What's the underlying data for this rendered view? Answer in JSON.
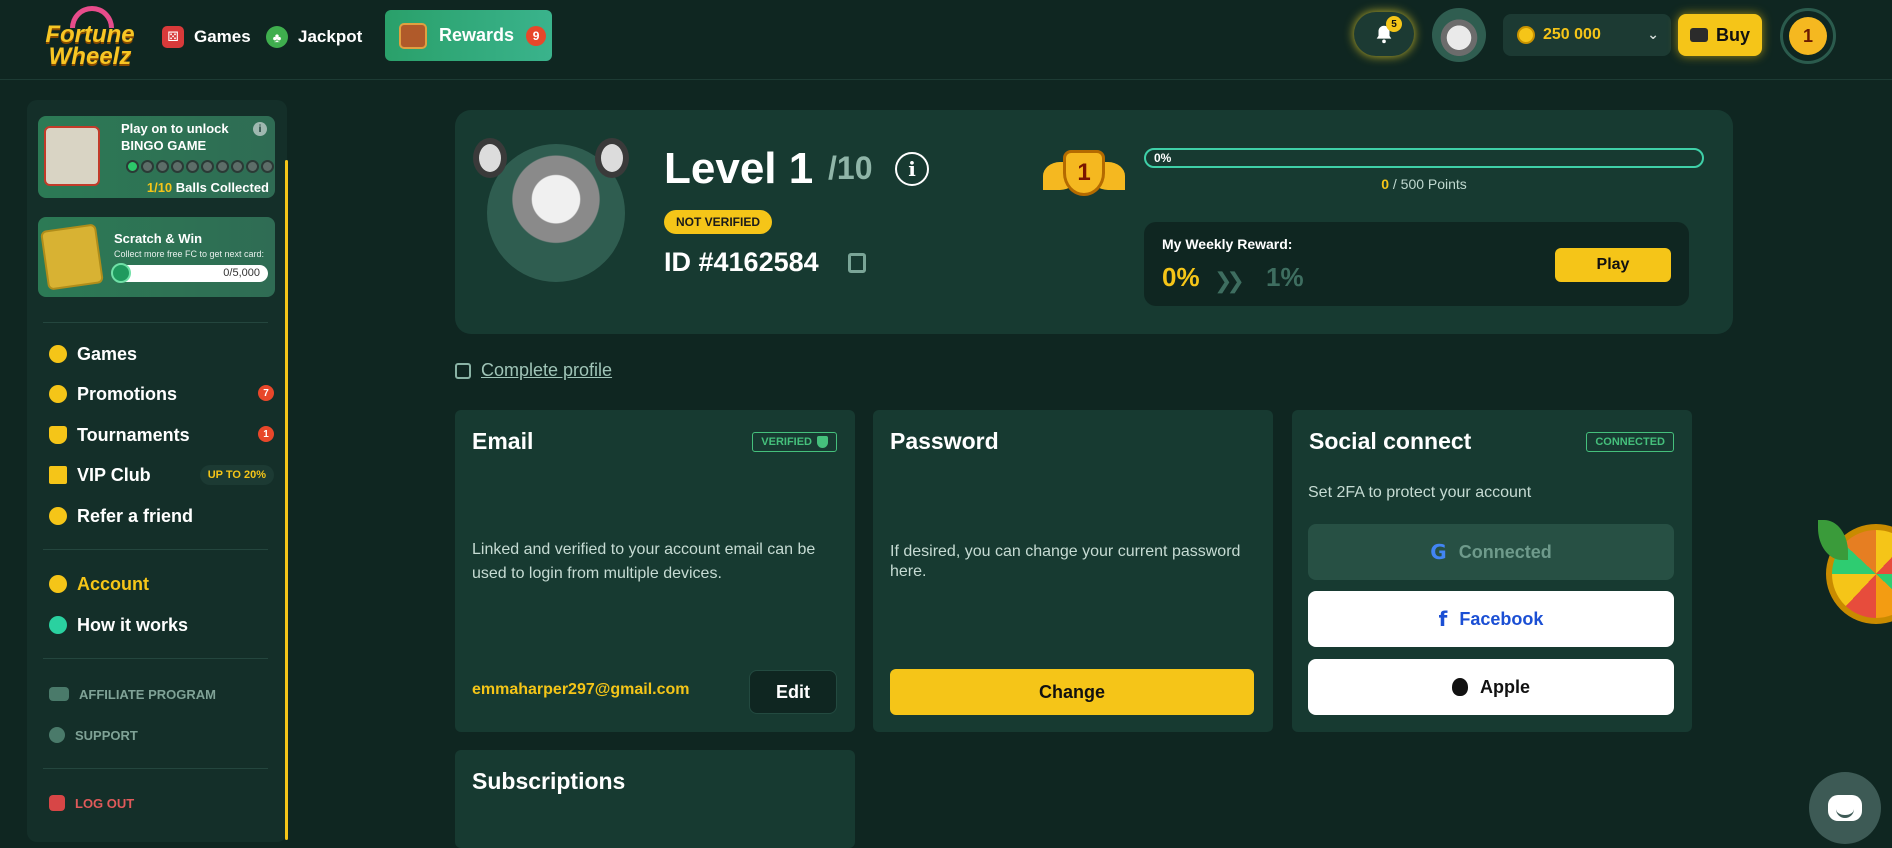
{
  "header": {
    "logo_text": "Fortune Wheelz",
    "nav": {
      "games_label": "Games",
      "jackpot_label": "Jackpot",
      "rewards_label": "Rewards",
      "rewards_badge": "9"
    },
    "notifications_badge": "5",
    "balance": "250 000",
    "buy_label": "Buy",
    "level_badge": "1"
  },
  "sidebar": {
    "bingo": {
      "title": "Play on to unlock BINGO GAME",
      "balls_collected": "1/10",
      "balls_label": "Balls Collected",
      "balls_on": 1,
      "balls_total": 10
    },
    "scratch": {
      "title": "Scratch & Win",
      "subtitle": "Collect more free FC to get next card:",
      "progress": "0/5,000"
    },
    "items": [
      {
        "label": "Games"
      },
      {
        "label": "Promotions",
        "badge": "7"
      },
      {
        "label": "Tournaments",
        "badge": "1"
      },
      {
        "label": "VIP Club",
        "tag": "UP TO 20%"
      },
      {
        "label": "Refer a friend"
      }
    ],
    "account_items": [
      {
        "label": "Account"
      },
      {
        "label": "How it works"
      }
    ],
    "links": [
      {
        "label": "AFFILIATE PROGRAM"
      },
      {
        "label": "SUPPORT"
      }
    ],
    "logout_label": "LOG OUT"
  },
  "level_card": {
    "title": "Level 1",
    "max": "/10",
    "info_icon": "i",
    "status": "NOT VERIFIED",
    "user_id": "ID #4162584",
    "medal_level": "1",
    "progress_text": "0%",
    "progress_fraction": 0,
    "points_current": "0",
    "points_rest": " / 500 Points",
    "weekly": {
      "label": "My Weekly Reward:",
      "current": "0%",
      "next": "1%",
      "play_label": "Play"
    }
  },
  "complete_profile_label": "Complete profile",
  "email_card": {
    "title": "Email",
    "tag": "VERIFIED",
    "description": "Linked and verified to your account email can be used to login from multiple devices.",
    "email": "emmaharper297@gmail.com",
    "edit_label": "Edit"
  },
  "password_card": {
    "title": "Password",
    "description": "If desired, you can change your current password here.",
    "change_label": "Change"
  },
  "social_card": {
    "title": "Social connect",
    "tag": "CONNECTED",
    "subtitle": "Set 2FA to protect your account",
    "google_label": "Connected",
    "facebook_label": "Facebook",
    "apple_label": "Apple",
    "google_icon": "G",
    "facebook_icon": "f"
  },
  "subscriptions_card": {
    "title": "Subscriptions"
  },
  "colors": {
    "background": "#0f2621",
    "card": "#173a31",
    "accent": "#f5c518",
    "success": "#45c07c",
    "danger": "#e05a5a"
  }
}
